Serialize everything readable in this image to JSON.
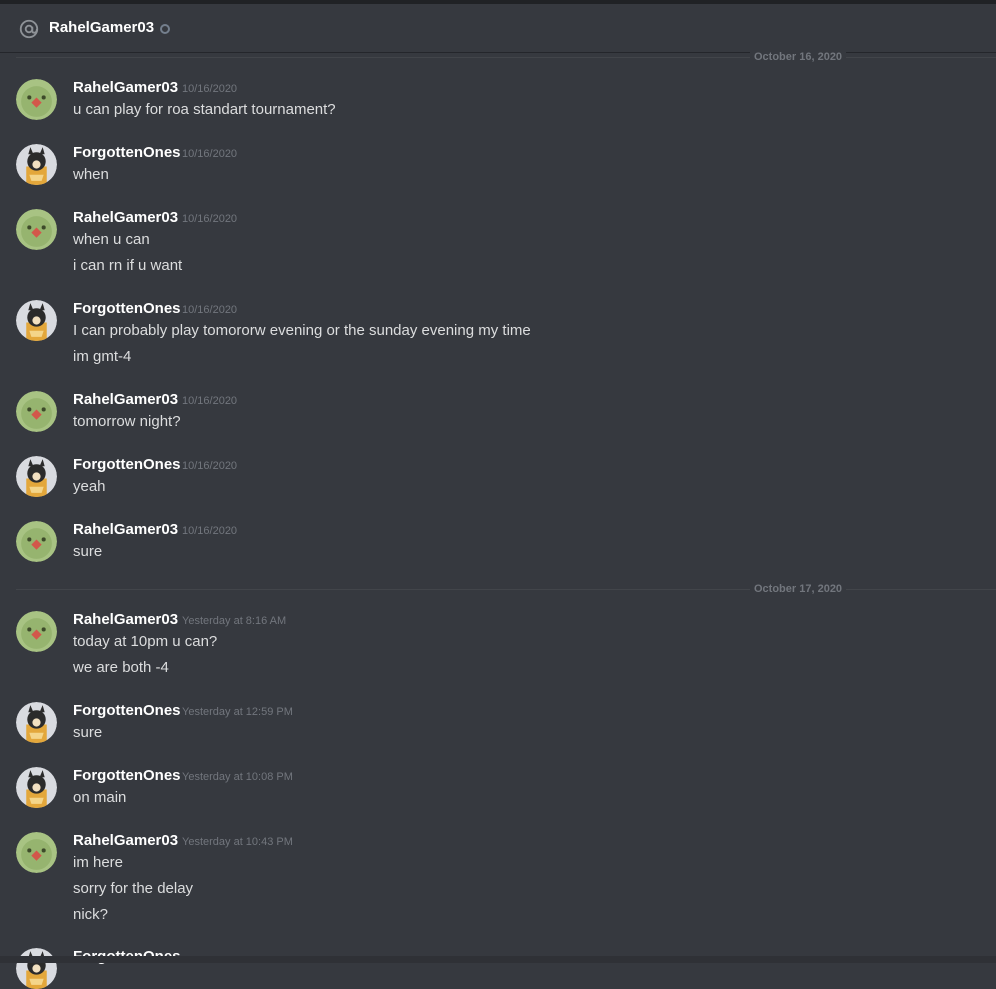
{
  "header": {
    "title": "RahelGamer03",
    "at_icon": "at-icon",
    "status": "offline"
  },
  "dividers": [
    "October 16, 2020",
    "October 17, 2020"
  ],
  "messages": [
    {
      "author": "RahelGamer03",
      "avatar": "green-bird-avatar",
      "time": "10/16/2020",
      "lines": [
        "u can play for roa standart tournament?"
      ]
    },
    {
      "author": "ForgottenOnes",
      "avatar": "shiba-avatar",
      "time": "10/16/2020",
      "lines": [
        "when"
      ]
    },
    {
      "author": "RahelGamer03",
      "avatar": "green-bird-avatar",
      "time": "10/16/2020",
      "lines": [
        "when u can",
        "i can rn if u want"
      ]
    },
    {
      "author": "ForgottenOnes",
      "avatar": "shiba-avatar",
      "time": "10/16/2020",
      "lines": [
        "I can probably play tomororw evening or the sunday evening my time",
        "im gmt-4"
      ]
    },
    {
      "author": "RahelGamer03",
      "avatar": "green-bird-avatar",
      "time": "10/16/2020",
      "lines": [
        "tomorrow night?"
      ]
    },
    {
      "author": "ForgottenOnes",
      "avatar": "shiba-avatar",
      "time": "10/16/2020",
      "lines": [
        "yeah"
      ]
    },
    {
      "author": "RahelGamer03",
      "avatar": "green-bird-avatar",
      "time": "10/16/2020",
      "lines": [
        "sure"
      ]
    },
    {
      "author": "RahelGamer03",
      "avatar": "green-bird-avatar",
      "time": "Yesterday at 8:16 AM",
      "lines": [
        "today at 10pm u can?",
        "we are both -4"
      ]
    },
    {
      "author": "ForgottenOnes",
      "avatar": "shiba-avatar",
      "time": "Yesterday at 12:59 PM",
      "lines": [
        "sure"
      ]
    },
    {
      "author": "ForgottenOnes",
      "avatar": "shiba-avatar",
      "time": "Yesterday at 10:08 PM",
      "lines": [
        "on main"
      ]
    },
    {
      "author": "RahelGamer03",
      "avatar": "green-bird-avatar",
      "time": "Yesterday at 10:43 PM",
      "lines": [
        "im here",
        "sorry for the delay",
        "nick?"
      ]
    },
    {
      "author": "ForgottenOnes",
      "avatar": "shiba-avatar",
      "time": "",
      "lines": []
    }
  ]
}
